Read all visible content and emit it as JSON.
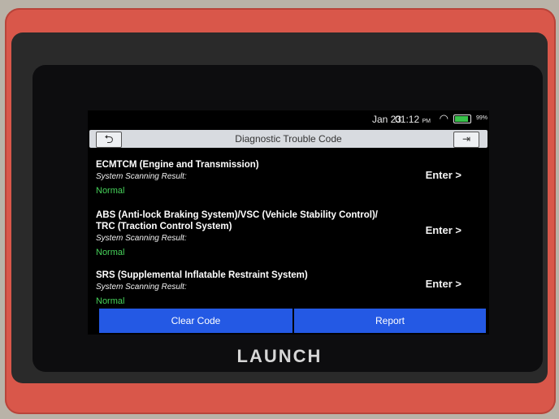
{
  "status": {
    "date": "Jan 23",
    "time": "01:12",
    "ampm": "PM",
    "battery_pct": "99%",
    "battery_level": 0.99,
    "wifi_icon": "wifi-icon",
    "battery_icon": "battery-icon"
  },
  "header": {
    "title": "Diagnostic Trouble Code",
    "back_icon": "back-arrow-icon",
    "exit_icon": "exit-icon"
  },
  "systems": [
    {
      "name_line1": "ECMTCM (Engine and Transmission)",
      "name_line2": "",
      "label": "System Scanning Result:",
      "result": "Normal",
      "enter": "Enter >"
    },
    {
      "name_line1": "ABS (Anti-lock Braking System)/VSC (Vehicle Stability Control)/",
      "name_line2": "TRC (Traction Control System)",
      "label": "System Scanning Result:",
      "result": "Normal",
      "enter": "Enter >"
    },
    {
      "name_line1": "SRS (Supplemental Inflatable Restraint System)",
      "name_line2": "",
      "label": "System Scanning Result:",
      "result": "Normal",
      "enter": "Enter >"
    }
  ],
  "buttons": {
    "clear": "Clear Code",
    "report": "Report"
  },
  "brand": "LAUNCH",
  "colors": {
    "accent": "#2459e4",
    "normal": "#46d25a",
    "device": "#d9574a"
  }
}
